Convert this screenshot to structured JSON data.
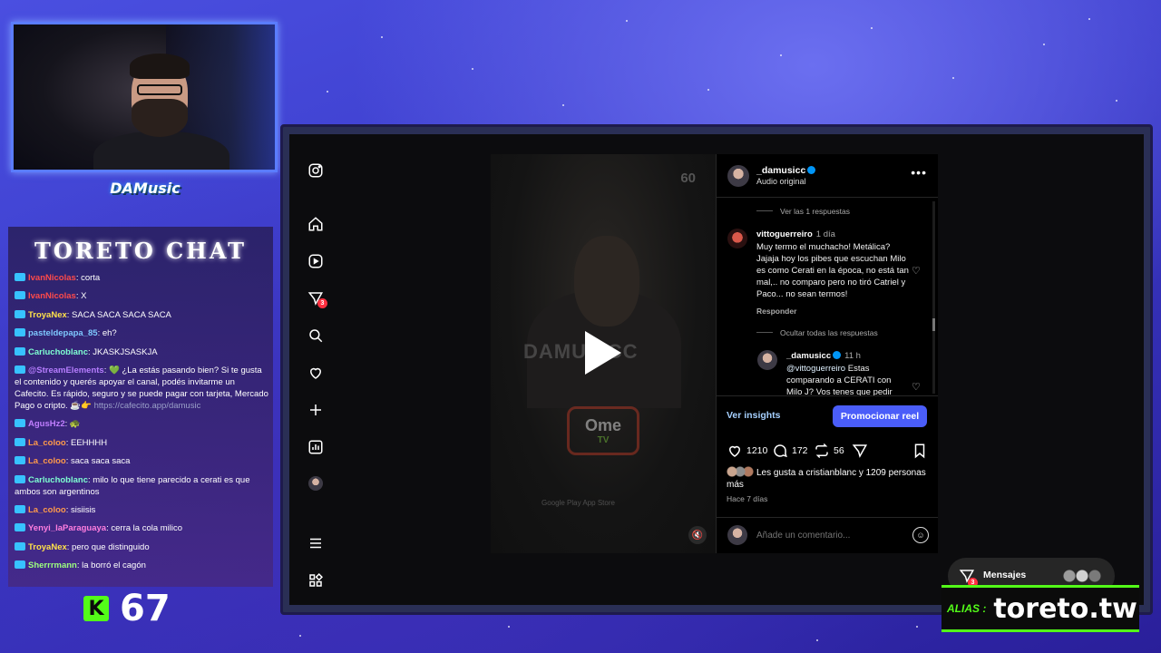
{
  "overlay": {
    "streamer_logo": "DAMusic",
    "chat_title": "TORETO CHAT",
    "kick_logo": "K",
    "viewer_count": "67",
    "alias_label": "ALIAS :",
    "alias_value": "toreto.tw"
  },
  "chat": [
    {
      "user": "IvanNicolas",
      "color": "#ff4a4a",
      "text": ": corta"
    },
    {
      "user": "IvanNicolas",
      "color": "#ff4a4a",
      "text": ": X"
    },
    {
      "user": "TroyaNex",
      "color": "#ffe14a",
      "text": ": SACA SACA SACA SACA"
    },
    {
      "user": "pasteldepapa_85",
      "color": "#7ec8ff",
      "text": ": eh?"
    },
    {
      "user": "Carluchoblanc",
      "color": "#7effd2",
      "text": ": JKASKJSASKJA"
    },
    {
      "user": "@StreamElements",
      "color": "#b77eff",
      "text": ": 💚 ¿La estás pasando bien? Si te gusta el contenido y querés apoyar el canal, podés invitarme un Cafecito. Es rápido, seguro y se puede pagar con tarjeta, Mercado Pago o cripto. ☕👉",
      "link": "https://cafecito.app/damusic"
    },
    {
      "user": "AgusHz2",
      "color": "#c07eff",
      "text": ": 🐢"
    },
    {
      "user": "La_coloo",
      "color": "#ff9a4a",
      "text": ": EEHHHH"
    },
    {
      "user": "La_coloo",
      "color": "#ff9a4a",
      "text": ": saca saca saca"
    },
    {
      "user": "Carluchoblanc",
      "color": "#7effd2",
      "text": ": milo lo que tiene parecido a cerati es que ambos son argentinos"
    },
    {
      "user": "La_coloo",
      "color": "#ff9a4a",
      "text": ": sisiisis"
    },
    {
      "user": "Yenyi_laParaguaya",
      "color": "#ff7ee0",
      "text": ": cerra la cola milico"
    },
    {
      "user": "TroyaNex",
      "color": "#ffe14a",
      "text": ": pero que distinguido"
    },
    {
      "user": "Sherrrmann",
      "color": "#9dff7e",
      "text": ": la borró el cagón"
    }
  ],
  "instagram": {
    "nav_badge": "3",
    "reel": {
      "brand": "DAMUSICC",
      "kick_count": "60",
      "ome": "Ome",
      "ome_tv": "TV",
      "stores": "Google Play   App Store"
    },
    "post": {
      "username": "_damusicc",
      "subtitle": "Audio original",
      "more": "•••",
      "view_replies": "Ver las 1 respuestas",
      "comment1_user": "vittoguerreiro",
      "comment1_time": "1 día",
      "comment1_text": "Muy termo el muchacho! Metálica? Jajaja hoy los pibes que escuchan Milo es como Cerati en la época, no está tan mal,.. no comparo pero no tiró Catriel y Paco... no sean termos!",
      "reply_label": "Responder",
      "hide_replies": "Ocultar todas las respuestas",
      "reply_user": "_damusicc",
      "reply_time": "11 h",
      "reply_mention": "@vittoguerreiro",
      "reply_text": " Estas comparando a CERATI con Milo J? Vos tenes que pedir",
      "insights": "Ver insights",
      "promote": "Promocionar reel",
      "likes_count": "1210",
      "comments_count": "172",
      "reposts_count": "56",
      "liked_by": "Les gusta a cristianblanc y 1209 personas más",
      "time_ago": "Hace 7 días",
      "add_comment_placeholder": "Añade un comentario...",
      "messages_label": "Mensajes",
      "messages_badge": "3"
    }
  }
}
